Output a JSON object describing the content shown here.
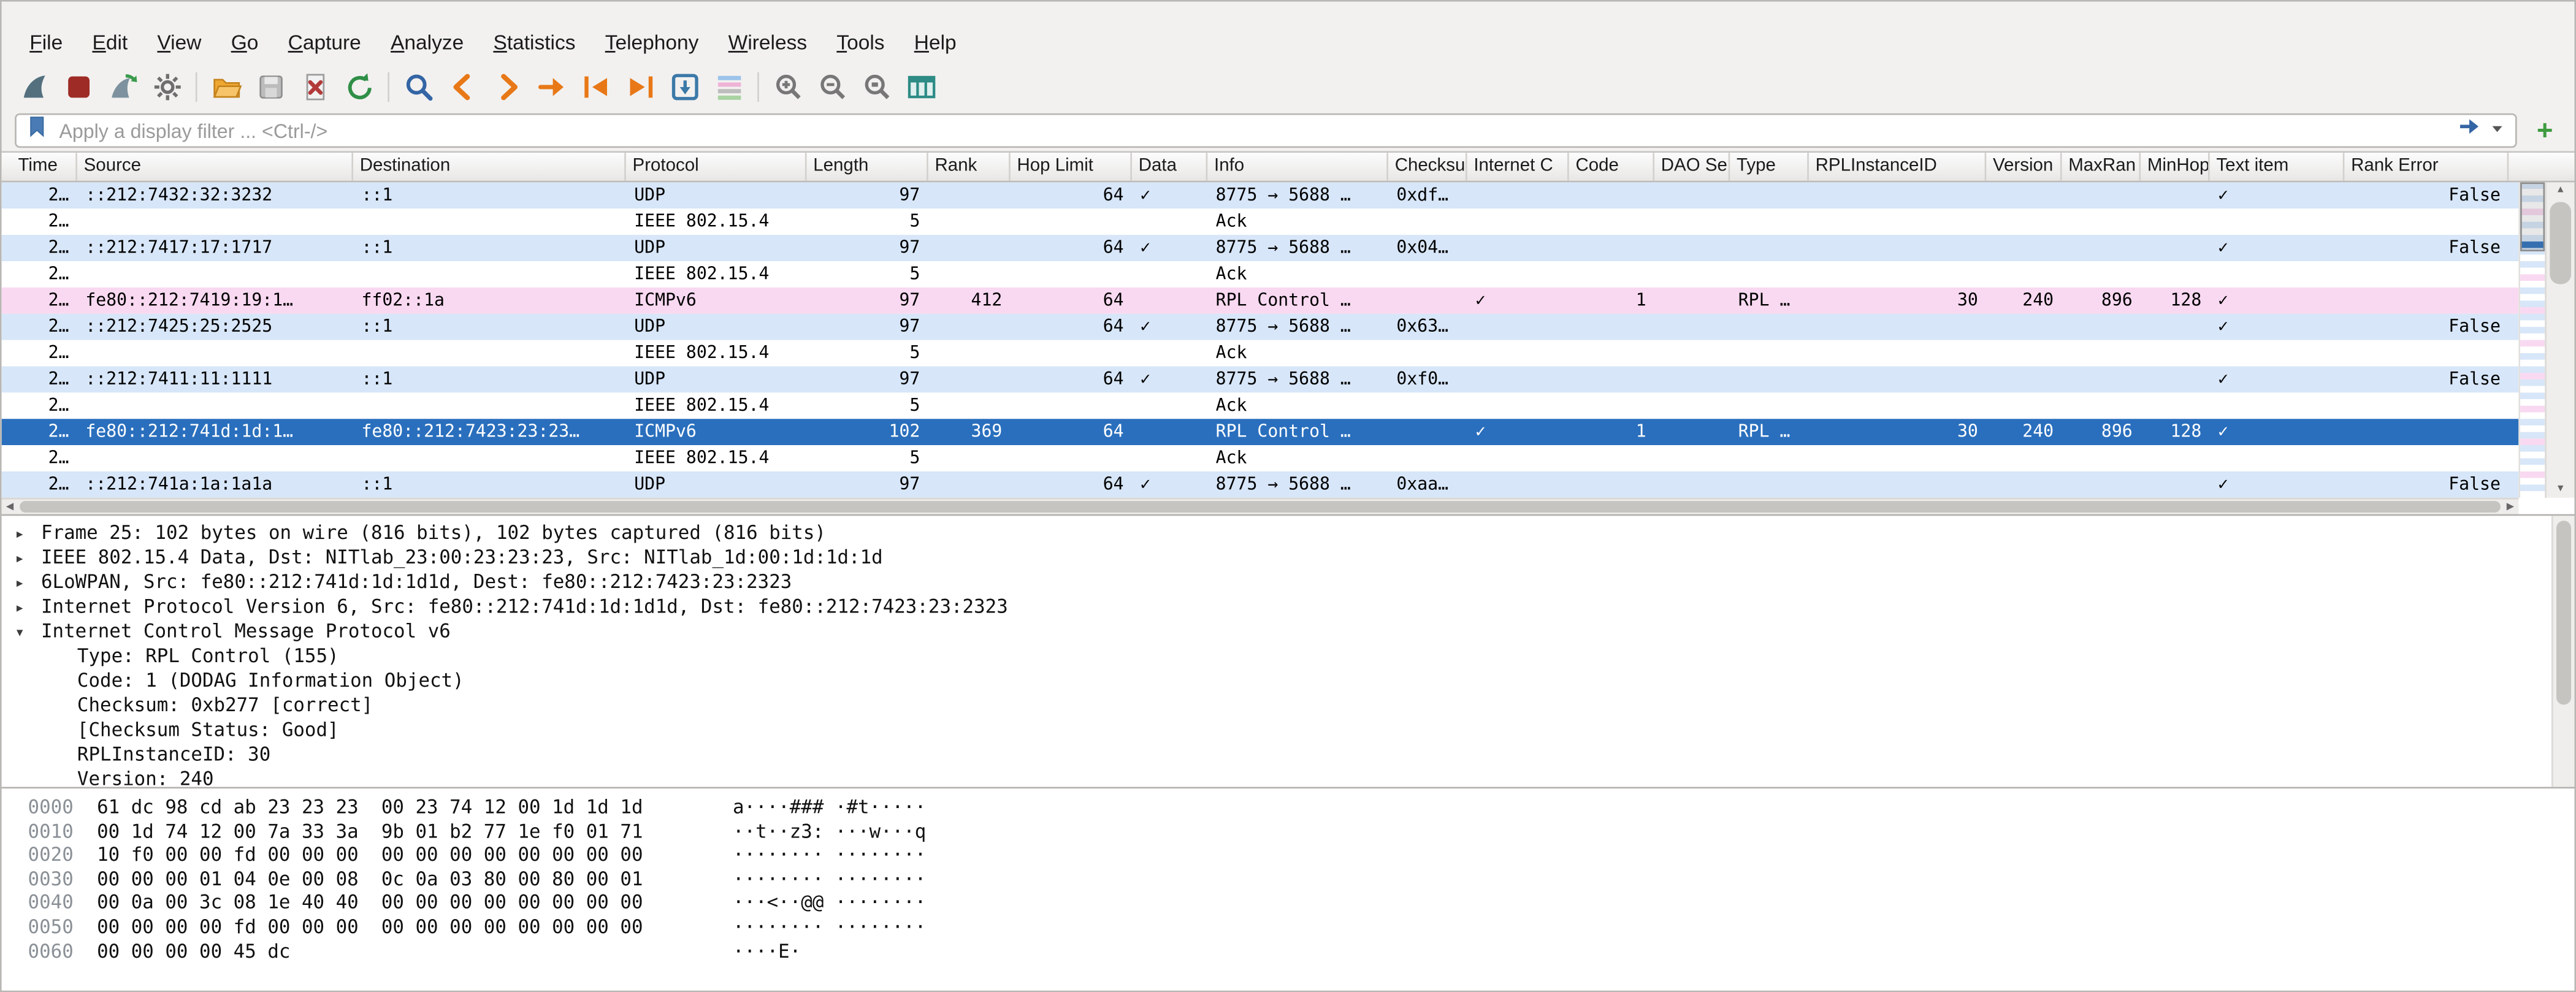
{
  "window": {
    "title": "Wireshark"
  },
  "colors": {
    "udp_row": "#d7e6f8",
    "icmp_row": "#f9d9f1",
    "ack_row": "#ffffff",
    "selected_row": "#2a6fbd",
    "selected_text": "#ffffff",
    "accent_orange": "#e87817",
    "accent_blue": "#3465a4",
    "accent_green": "#2f8f46"
  },
  "menu": {
    "items": [
      "File",
      "Edit",
      "View",
      "Go",
      "Capture",
      "Analyze",
      "Statistics",
      "Telephony",
      "Wireless",
      "Tools",
      "Help"
    ]
  },
  "toolbar": {
    "buttons": [
      {
        "name": "start-capture-button",
        "icon": "fin"
      },
      {
        "name": "stop-capture-button",
        "icon": "stop"
      },
      {
        "name": "restart-capture-button",
        "icon": "restart"
      },
      {
        "name": "capture-options-button",
        "icon": "gear"
      },
      {
        "sep": true
      },
      {
        "name": "open-file-button",
        "icon": "folder"
      },
      {
        "name": "save-file-button",
        "icon": "save"
      },
      {
        "name": "close-file-button",
        "icon": "close"
      },
      {
        "name": "reload-file-button",
        "icon": "reload"
      },
      {
        "sep": true
      },
      {
        "name": "find-packet-button",
        "icon": "find"
      },
      {
        "name": "go-back-button",
        "icon": "back"
      },
      {
        "name": "go-forward-button",
        "icon": "forward"
      },
      {
        "name": "go-to-packet-button",
        "icon": "goto"
      },
      {
        "name": "go-first-packet-button",
        "icon": "first"
      },
      {
        "name": "go-last-packet-button",
        "icon": "last"
      },
      {
        "name": "auto-scroll-button",
        "icon": "autoscroll"
      },
      {
        "name": "colorize-button",
        "icon": "colorize"
      },
      {
        "sep": true
      },
      {
        "name": "zoom-in-button",
        "icon": "zoomin"
      },
      {
        "name": "zoom-out-button",
        "icon": "zoomout"
      },
      {
        "name": "zoom-original-button",
        "icon": "zoomorig"
      },
      {
        "name": "resize-columns-button",
        "icon": "resizecols"
      }
    ]
  },
  "filter": {
    "placeholder": "Apply a display filter ... <Ctrl-/>",
    "add_button": "+"
  },
  "packet_list": {
    "columns": [
      {
        "id": "time",
        "label": "Time",
        "width": 40,
        "align": "right"
      },
      {
        "id": "source",
        "label": "Source",
        "width": 168,
        "align": "left"
      },
      {
        "id": "destination",
        "label": "Destination",
        "width": 166,
        "align": "left"
      },
      {
        "id": "protocol",
        "label": "Protocol",
        "width": 110,
        "align": "left"
      },
      {
        "id": "length",
        "label": "Length",
        "width": 74,
        "align": "right"
      },
      {
        "id": "rank",
        "label": "Rank",
        "width": 50,
        "align": "right"
      },
      {
        "id": "hop_limit",
        "label": "Hop Limit",
        "width": 74,
        "align": "right"
      },
      {
        "id": "data",
        "label": "Data",
        "width": 46,
        "align": "left"
      },
      {
        "id": "info",
        "label": "Info",
        "width": 110,
        "align": "left"
      },
      {
        "id": "checksum",
        "label": "Checksu",
        "width": 48,
        "align": "left"
      },
      {
        "id": "internet_c",
        "label": "Internet C",
        "width": 62,
        "align": "left"
      },
      {
        "id": "code",
        "label": "Code",
        "width": 52,
        "align": "right"
      },
      {
        "id": "dao_se",
        "label": "DAO Se",
        "width": 46,
        "align": "left"
      },
      {
        "id": "type",
        "label": "Type",
        "width": 48,
        "align": "left"
      },
      {
        "id": "rpl_instance_id",
        "label": "RPLInstanceID",
        "width": 108,
        "align": "right"
      },
      {
        "id": "version",
        "label": "Version",
        "width": 46,
        "align": "right"
      },
      {
        "id": "maxran",
        "label": "MaxRan",
        "width": 48,
        "align": "right"
      },
      {
        "id": "minhop",
        "label": "MinHop",
        "width": 42,
        "align": "right"
      },
      {
        "id": "text_item",
        "label": "Text item",
        "width": 82,
        "align": "left"
      },
      {
        "id": "rank_error",
        "label": "Rank Error",
        "width": 100,
        "align": "right"
      }
    ],
    "rows": [
      {
        "color": "udp",
        "time": "2…",
        "source": "::212:7432:32:3232",
        "destination": "::1",
        "protocol": "UDP",
        "length": "97",
        "hop_limit": "64",
        "data": "✓",
        "info": "8775 → 5688 …",
        "checksum": "0xdf…",
        "text_item": "✓",
        "rank_error": "False"
      },
      {
        "color": "ack",
        "time": "2…",
        "protocol": "IEEE 802.15.4",
        "length": "5",
        "info": "Ack"
      },
      {
        "color": "udp",
        "time": "2…",
        "source": "::212:7417:17:1717",
        "destination": "::1",
        "protocol": "UDP",
        "length": "97",
        "hop_limit": "64",
        "data": "✓",
        "info": "8775 → 5688 …",
        "checksum": "0x04…",
        "text_item": "✓",
        "rank_error": "False"
      },
      {
        "color": "ack",
        "time": "2…",
        "protocol": "IEEE 802.15.4",
        "length": "5",
        "info": "Ack"
      },
      {
        "color": "icmp",
        "time": "2…",
        "source": "fe80::212:7419:19:1…",
        "destination": "ff02::1a",
        "protocol": "ICMPv6",
        "length": "97",
        "rank": "412",
        "hop_limit": "64",
        "info": "RPL Control …",
        "internet_c": "✓",
        "code": "1",
        "type": "RPL …",
        "rpl_instance_id": "30",
        "version": "240",
        "maxran": "896",
        "minhop": "128",
        "text_item": "✓"
      },
      {
        "color": "udp",
        "time": "2…",
        "source": "::212:7425:25:2525",
        "destination": "::1",
        "protocol": "UDP",
        "length": "97",
        "hop_limit": "64",
        "data": "✓",
        "info": "8775 → 5688 …",
        "checksum": "0x63…",
        "text_item": "✓",
        "rank_error": "False"
      },
      {
        "color": "ack",
        "time": "2…",
        "protocol": "IEEE 802.15.4",
        "length": "5",
        "info": "Ack"
      },
      {
        "color": "udp",
        "time": "2…",
        "source": "::212:7411:11:1111",
        "destination": "::1",
        "protocol": "UDP",
        "length": "97",
        "hop_limit": "64",
        "data": "✓",
        "info": "8775 → 5688 …",
        "checksum": "0xf0…",
        "text_item": "✓",
        "rank_error": "False"
      },
      {
        "color": "ack",
        "time": "2…",
        "protocol": "IEEE 802.15.4",
        "length": "5",
        "info": "Ack"
      },
      {
        "color": "icmp",
        "selected": true,
        "time": "2…",
        "source": "fe80::212:741d:1d:1…",
        "destination": "fe80::212:7423:23:23…",
        "protocol": "ICMPv6",
        "length": "102",
        "rank": "369",
        "hop_limit": "64",
        "info": "RPL Control …",
        "internet_c": "✓",
        "code": "1",
        "type": "RPL …",
        "rpl_instance_id": "30",
        "version": "240",
        "maxran": "896",
        "minhop": "128",
        "text_item": "✓"
      },
      {
        "color": "ack",
        "time": "2…",
        "protocol": "IEEE 802.15.4",
        "length": "5",
        "info": "Ack"
      },
      {
        "color": "udp",
        "time": "2…",
        "source": "::212:741a:1a:1a1a",
        "destination": "::1",
        "protocol": "UDP",
        "length": "97",
        "hop_limit": "64",
        "data": "✓",
        "info": "8775 → 5688 …",
        "checksum": "0xaa…",
        "text_item": "✓",
        "rank_error": "False"
      }
    ]
  },
  "details": {
    "lines": [
      {
        "arrow": "▸",
        "indent": 0,
        "text": "Frame 25: 102 bytes on wire (816 bits), 102 bytes captured (816 bits)"
      },
      {
        "arrow": "▸",
        "indent": 0,
        "text": "IEEE 802.15.4 Data, Dst: NITlab_23:00:23:23:23, Src: NITlab_1d:00:1d:1d:1d"
      },
      {
        "arrow": "▸",
        "indent": 0,
        "text": "6LoWPAN, Src: fe80::212:741d:1d:1d1d, Dest: fe80::212:7423:23:2323"
      },
      {
        "arrow": "▸",
        "indent": 0,
        "text": "Internet Protocol Version 6, Src: fe80::212:741d:1d:1d1d, Dst: fe80::212:7423:23:2323"
      },
      {
        "arrow": "▾",
        "indent": 0,
        "text": "Internet Control Message Protocol v6"
      },
      {
        "arrow": null,
        "indent": 1,
        "text": "Type: RPL Control (155)"
      },
      {
        "arrow": null,
        "indent": 1,
        "text": "Code: 1 (DODAG Information Object)"
      },
      {
        "arrow": null,
        "indent": 1,
        "text": "Checksum: 0xb277 [correct]"
      },
      {
        "arrow": null,
        "indent": 1,
        "text": "[Checksum Status: Good]"
      },
      {
        "arrow": null,
        "indent": 1,
        "text": "RPLInstanceID: 30"
      },
      {
        "arrow": null,
        "indent": 1,
        "text": "Version: 240"
      }
    ]
  },
  "hex_dump": {
    "lines": [
      {
        "offset": "0000",
        "hex": "61 dc 98 cd ab 23 23 23  00 23 74 12 00 1d 1d 1d",
        "ascii": "a····### ·#t·····"
      },
      {
        "offset": "0010",
        "hex": "00 1d 74 12 00 7a 33 3a  9b 01 b2 77 1e f0 01 71",
        "ascii": "··t··z3: ···w···q"
      },
      {
        "offset": "0020",
        "hex": "10 f0 00 00 fd 00 00 00  00 00 00 00 00 00 00 00",
        "ascii": "········ ········"
      },
      {
        "offset": "0030",
        "hex": "00 00 00 01 04 0e 00 08  0c 0a 03 80 00 80 00 01",
        "ascii": "········ ········"
      },
      {
        "offset": "0040",
        "hex": "00 0a 00 3c 08 1e 40 40  00 00 00 00 00 00 00 00",
        "ascii": "···<··@@ ········"
      },
      {
        "offset": "0050",
        "hex": "00 00 00 00 fd 00 00 00  00 00 00 00 00 00 00 00",
        "ascii": "········ ········"
      },
      {
        "offset": "0060",
        "hex": "00 00 00 00 45 dc",
        "ascii": "····E·"
      }
    ]
  }
}
